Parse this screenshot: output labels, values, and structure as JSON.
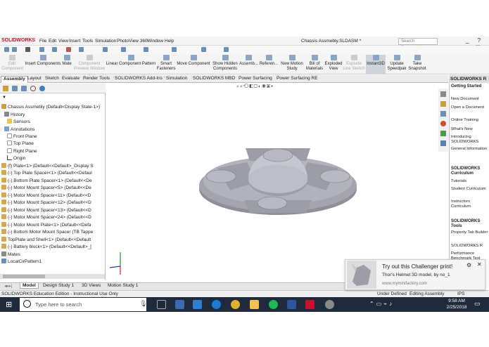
{
  "app": {
    "brand": "SOLIDWORKS",
    "document_title": "Chassis Assmebly.SLDASM *"
  },
  "menu": [
    "File",
    "Edit",
    "View",
    "Insert",
    "Tools",
    "Simulation",
    "PhotoView 360",
    "Window",
    "Help"
  ],
  "search": {
    "placeholder": "Search Commands"
  },
  "window_controls": "_ ? - □ ×",
  "ribbon": [
    {
      "label": "Edit\nComponent",
      "disabled": true
    },
    {
      "label": "Insert Components",
      "disabled": false
    },
    {
      "label": "Mate",
      "disabled": false
    },
    {
      "label": "Component\nPreview Window",
      "disabled": true
    },
    {
      "label": "Linear Component Pattern",
      "disabled": false
    },
    {
      "label": "Smart\nFasteners",
      "disabled": false
    },
    {
      "label": "Move Component",
      "disabled": false
    },
    {
      "label": "Show Hidden\nComponents",
      "disabled": false
    },
    {
      "label": "Assemb...",
      "disabled": false
    },
    {
      "label": "Referen...",
      "disabled": false
    },
    {
      "label": "New Motion\nStudy",
      "disabled": false
    },
    {
      "label": "Bill of\nMaterials",
      "disabled": false
    },
    {
      "label": "Exploded\nView",
      "disabled": false
    },
    {
      "label": "Explode\nLine Sketch",
      "disabled": true
    },
    {
      "label": "Instant3D",
      "disabled": false,
      "active": true
    },
    {
      "label": "Update\nSpeedpak",
      "disabled": false
    },
    {
      "label": "Take\nSnapshot",
      "disabled": false
    }
  ],
  "command_tabs": [
    "Assembly",
    "Layout",
    "Sketch",
    "Evaluate",
    "Render Tools",
    "SOLIDWORKS Add-Ins",
    "Simulation",
    "SOLIDWORKS MBD",
    "Power Surfacing",
    "Power Surfacing RE"
  ],
  "active_command_tab": "Assembly",
  "feature_tree": {
    "root": "Chassis Assmebly  (Default<Display State-1>)",
    "items": [
      "History",
      "Sensors",
      "Annotations",
      "Front Plane",
      "Top Plane",
      "Right Plane",
      "Origin",
      "(f) Plate<1> (Default<<Default>_Display S",
      "(-) Top Plate Spacer<1> (Default<<Defaul",
      "(-) Bottom Plate Spacer<1> (Default<<De",
      "(-) Motor Mount Spacer<5> (Default<<De",
      "(-) Motor Mount Spacer<11> (Default<<D",
      "(-) Motor Mount Spacer<12> (Default<<D",
      "(-) Motor Mount Spacer<13> (Default<<D",
      "(-) Motor Mount Spacer<24> (Default<<D",
      "(-) Motor Mount Plate<1> (Default<<Defa",
      "(-) Bottom Motor Mount Spacer (TB Tappe",
      "TopPlate and Shell<1> (Default<<Default",
      "(-) Battery block<1> (Default<<Default>_[",
      "Mates",
      "LocalCirPattern1"
    ]
  },
  "task_pane": {
    "title": "SOLIDWORKS R",
    "sections": [
      {
        "heading": "Getting Started",
        "links": [
          "New Document",
          "Open a Document",
          "Online Training",
          "What's New",
          "Introducing SOLIDWORKS",
          "General Information"
        ]
      },
      {
        "heading": "SOLIDWORKS Curriculum",
        "links": [
          "Tutorials",
          "Student Curriculum",
          "Instructors Curriculum"
        ]
      },
      {
        "heading": "SOLIDWORKS Tools",
        "links": [
          "Property Tab Builder",
          "SOLIDWORKS R",
          "Performance Benchmark Test"
        ]
      }
    ]
  },
  "bottom_tabs": [
    "Model",
    "Design Study 1",
    "3D Views",
    "Motion Study 1"
  ],
  "status": {
    "left": "SOLIDWORKS Education Edition - Instructional Use Only",
    "state": "Under Defined",
    "mode": "Editing Assembly",
    "units": "IPS"
  },
  "notification": {
    "title": "Try out this Challenger print!",
    "body": "Thor's Helmet 3D model, by no_1",
    "url": "www.myminifactory.com"
  },
  "taskbar": {
    "search_placeholder": "Type here to search",
    "time": "9:58 AM",
    "date": "2/25/2018"
  },
  "colors": {
    "brand": "#c8102e",
    "taskbar": "#1f2a3a",
    "model": "#a9aab3"
  }
}
